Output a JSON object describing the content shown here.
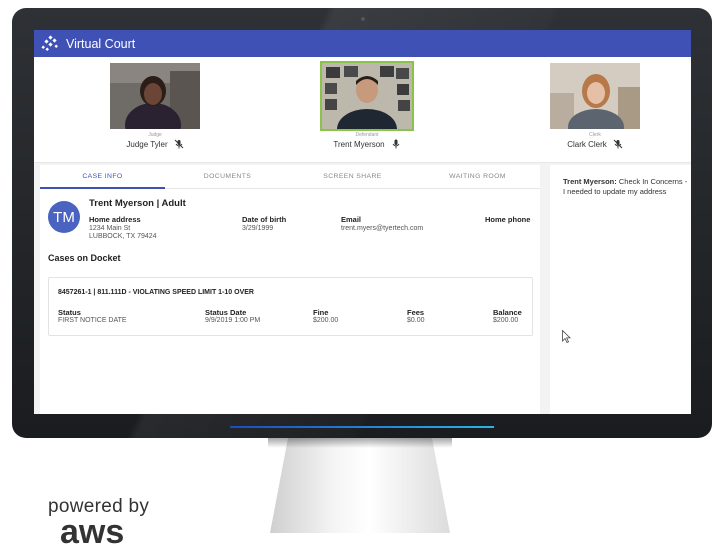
{
  "app": {
    "title": "Virtual Court"
  },
  "participants": [
    {
      "role": "Judge",
      "name": "Judge Tyler",
      "mic": "mic-off-icon"
    },
    {
      "role": "Defendant",
      "name": "Trent Myerson",
      "mic": "mic-on-icon"
    },
    {
      "role": "Clerk",
      "name": "Clark Clerk",
      "mic": "mic-off-icon"
    }
  ],
  "tabs": [
    "CASE INFO",
    "DOCUMENTS",
    "SCREEN SHARE",
    "WAITING ROOM"
  ],
  "person": {
    "initials": "TM",
    "name": "Trent Myerson | Adult",
    "home_address_label": "Home address",
    "address_line1": "1234 Main St",
    "address_line2": "LUBBOCK, TX 79424",
    "dob_label": "Date of birth",
    "dob": "3/29/1999",
    "email_label": "Email",
    "email": "trent.myers@tyertech.com",
    "phone_label": "Home phone"
  },
  "docket": {
    "title": "Cases on Docket",
    "case_heading": "8457261-1 | 811.111D - VIOLATING SPEED LIMIT 1-10 OVER",
    "columns": [
      {
        "label": "Status",
        "value": "FIRST NOTICE DATE"
      },
      {
        "label": "Status Date",
        "value": "9/9/2019 1:00 PM"
      },
      {
        "label": "Fine",
        "value": "$200.00"
      },
      {
        "label": "Fees",
        "value": "$0.00"
      },
      {
        "label": "Balance",
        "value": "$200.00"
      }
    ]
  },
  "chat": {
    "sender": "Trent Myerson:",
    "message": "Check In Concerns - I needed to update my address"
  },
  "branding": {
    "powered_by": "powered by",
    "aws": "aws"
  },
  "colors": {
    "app_bar": "#3f51b5",
    "avatar": "#4a63c0",
    "active_speaker": "#8bc34a"
  }
}
